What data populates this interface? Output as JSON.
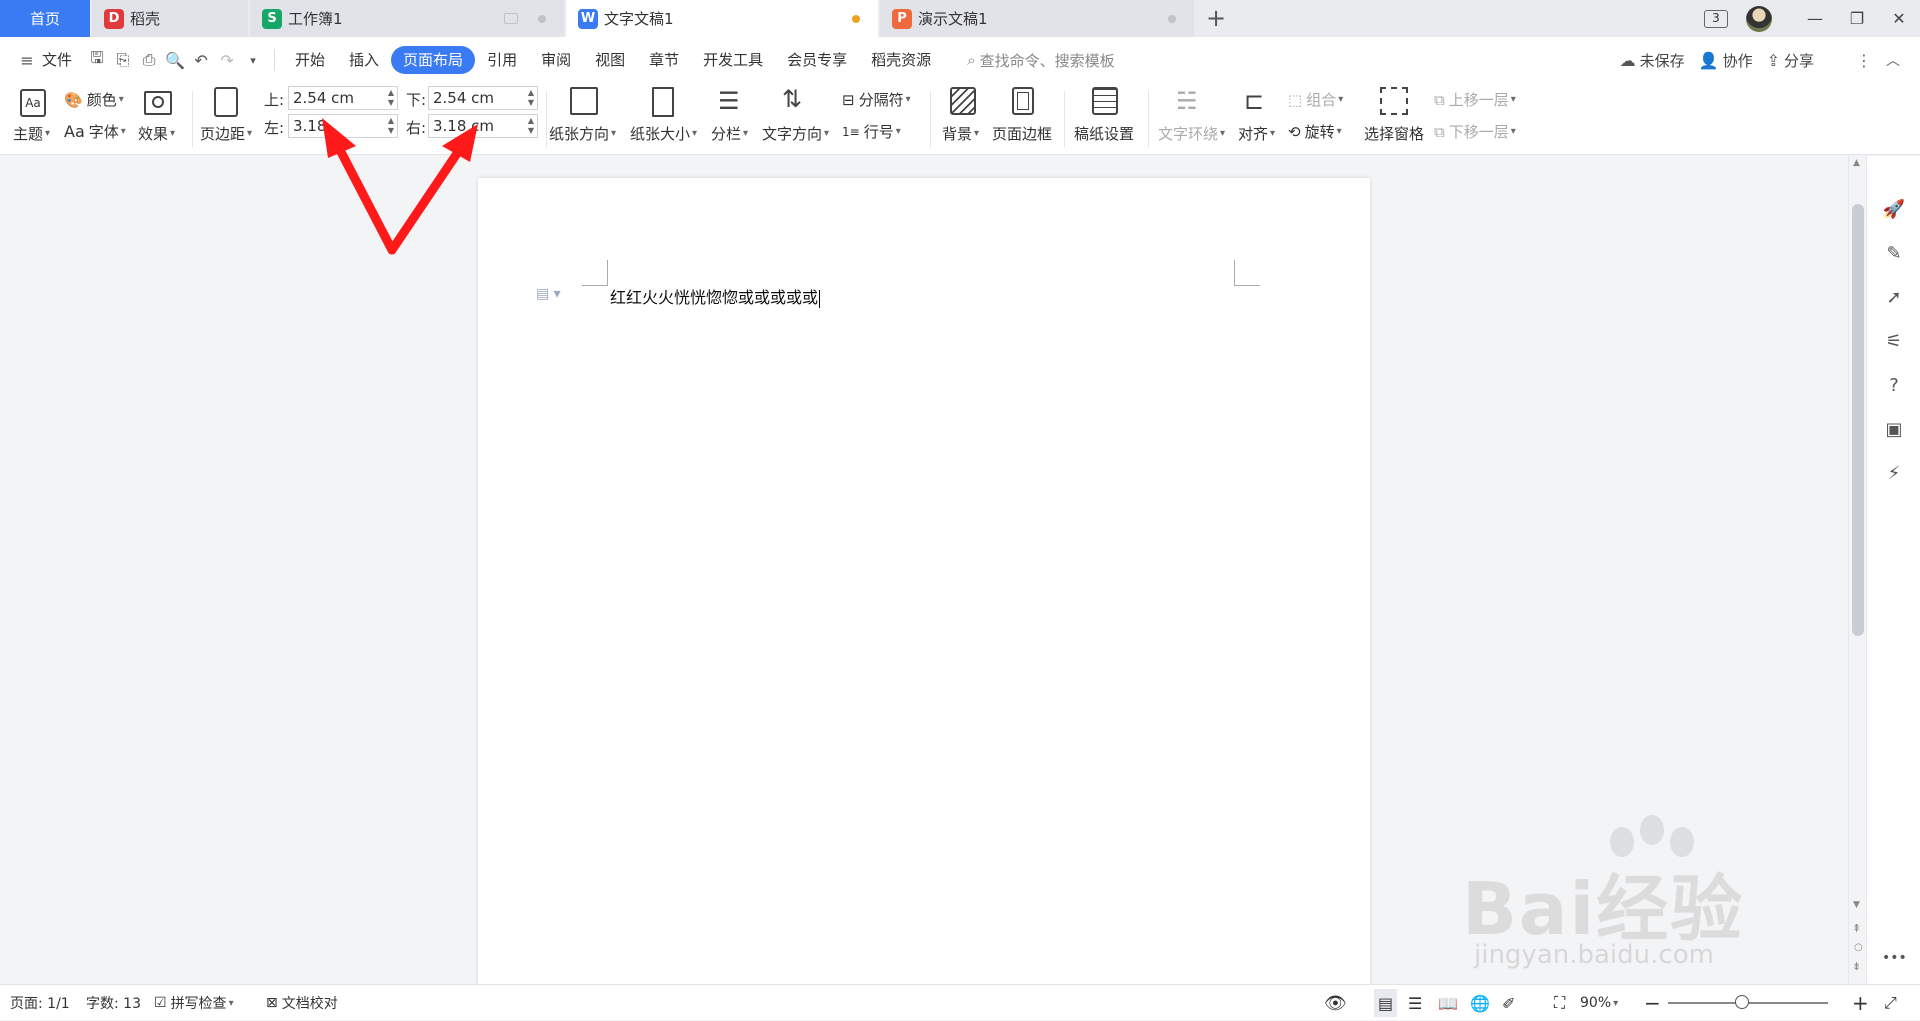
{
  "tabs": {
    "home": "首页",
    "items": [
      {
        "label": "稻壳",
        "logo": "D",
        "color": "#e0393e"
      },
      {
        "label": "工作簿1",
        "logo": "S",
        "color": "#17a768"
      },
      {
        "label": "文字文稿1",
        "logo": "W",
        "color": "#3a7af2"
      },
      {
        "label": "演示文稿1",
        "logo": "P",
        "color": "#ee6a3c"
      }
    ],
    "new_tab": "+"
  },
  "window": {
    "badge": "3"
  },
  "menu": {
    "file": "文件",
    "items": [
      "开始",
      "插入",
      "页面布局",
      "引用",
      "审阅",
      "视图",
      "章节",
      "开发工具",
      "会员专享",
      "稻壳资源"
    ],
    "active": "页面布局",
    "search_placeholder": "查找命令、搜索模板",
    "unsaved": "未保存",
    "collab": "协作",
    "share": "分享"
  },
  "ribbon": {
    "theme": "主题",
    "color": "颜色",
    "font": "字体",
    "font_prefix": "Aa",
    "effect": "效果",
    "margins": "页边距",
    "margin_top_label": "上:",
    "margin_top": "2.54 cm",
    "margin_bottom_label": "下:",
    "margin_bottom": "2.54 cm",
    "margin_left_label": "左:",
    "margin_left": "3.18",
    "margin_right_label": "右:",
    "margin_right": "3.18 cm",
    "orientation": "纸张方向",
    "size": "纸张大小",
    "columns": "分栏",
    "text_direction": "文字方向",
    "separator": "分隔符",
    "line_number": "行号",
    "background": "背景",
    "page_border": "页面边框",
    "draft_paper": "稿纸设置",
    "text_wrap": "文字环绕",
    "align": "对齐",
    "group": "组合",
    "rotate": "旋转",
    "selection_pane": "选择窗格",
    "bring_forward": "上移一层",
    "send_backward": "下移一层"
  },
  "document": {
    "text": "红红火火恍恍惚惚或或或或或"
  },
  "status": {
    "page": "页面: 1/1",
    "words": "字数: 13",
    "spell_check": "拼写检查",
    "proofread": "文档校对",
    "zoom": "90%"
  },
  "watermark": {
    "big": "Bai经验",
    "small": "jingyan.baidu.com"
  },
  "colors": {
    "accent": "#3a7af2",
    "arrow": "#ff1a1a"
  }
}
